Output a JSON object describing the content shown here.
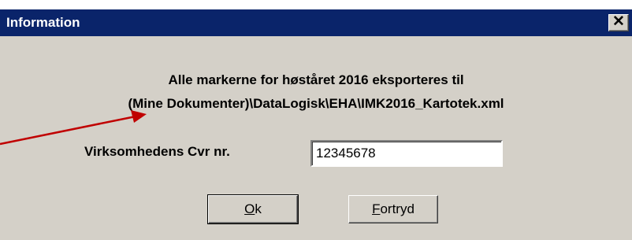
{
  "window": {
    "title": "Information",
    "close_symbol": "✕"
  },
  "message": {
    "line1": "Alle markerne for høståret 2016 eksporteres til",
    "line2": "(Mine Dokumenter)\\DataLogisk\\EHA\\IMK2016_Kartotek.xml"
  },
  "form": {
    "cvr_label": "Virksomhedens Cvr nr.",
    "cvr_value": "12345678"
  },
  "buttons": {
    "ok_mnemonic": "O",
    "ok_rest": "k",
    "cancel_mnemonic": "F",
    "cancel_rest": "ortryd"
  },
  "colors": {
    "titlebar": "#0a246a",
    "dialog_bg": "#d4d0c8",
    "annotation_arrow": "#c00000"
  },
  "icons": {
    "close": "close-icon",
    "annotation": "arrow-icon"
  }
}
